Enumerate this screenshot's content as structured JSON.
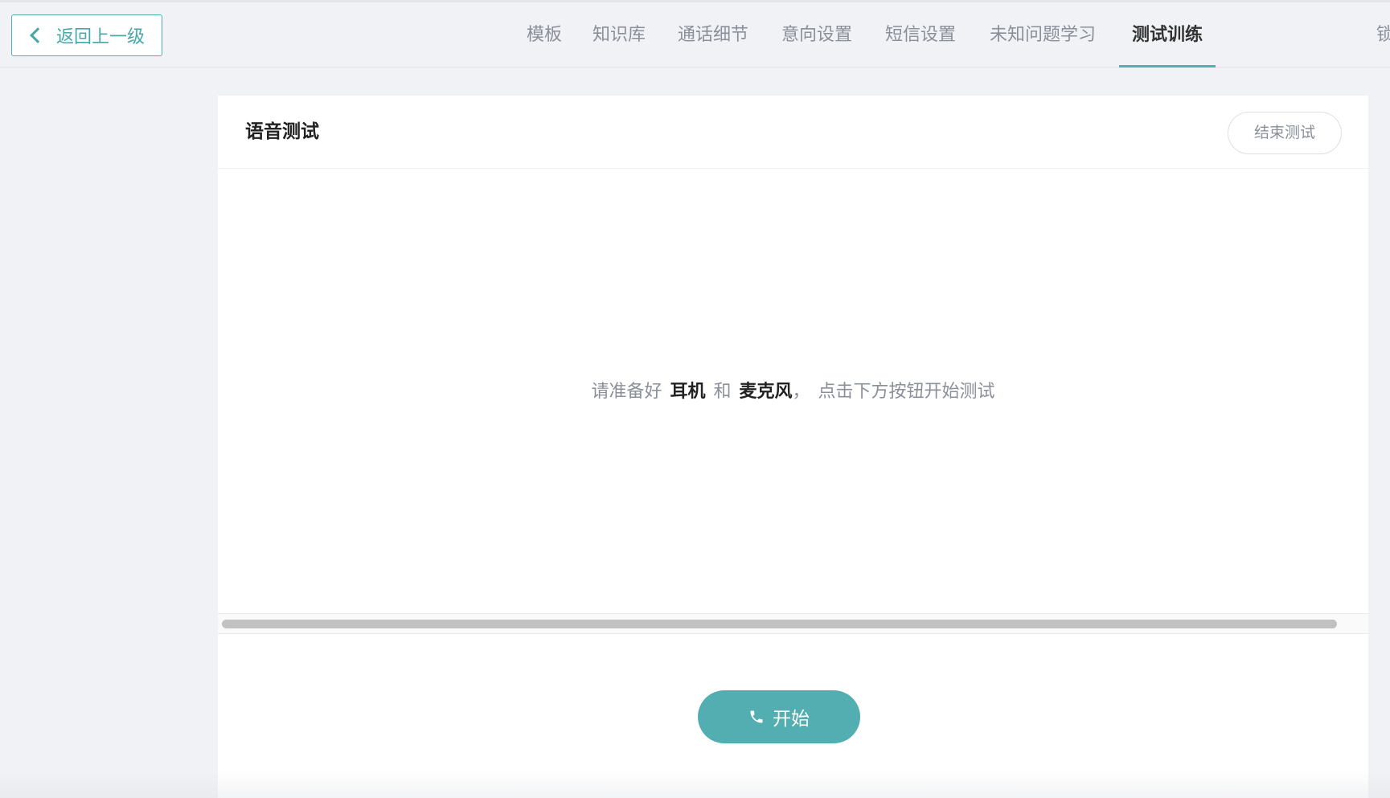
{
  "header": {
    "back_label": "返回上一级",
    "tabs": [
      {
        "label": "模板",
        "active": false
      },
      {
        "label": "知识库",
        "active": false
      },
      {
        "label": "通话细节",
        "active": false
      },
      {
        "label": "意向设置",
        "active": false
      },
      {
        "label": "短信设置",
        "active": false
      },
      {
        "label": "未知问题学习",
        "active": false
      },
      {
        "label": "测试训练",
        "active": true
      }
    ],
    "partial_tab_label": "锁"
  },
  "card": {
    "title": "语音测试",
    "end_test_label": "结束测试",
    "prompt": {
      "part1": "请准备好",
      "item1": "耳机",
      "joiner": "和",
      "item2": "麦克风",
      "comma": "，",
      "part2": "点击下方按钮开始测试"
    },
    "start_label": "开始"
  },
  "icons": {
    "back": "chevron-left-icon",
    "start": "phone-icon"
  },
  "colors": {
    "accent": "#52aeb0",
    "page_bg": "#f0f2f5",
    "muted_text": "#8a8f99"
  }
}
